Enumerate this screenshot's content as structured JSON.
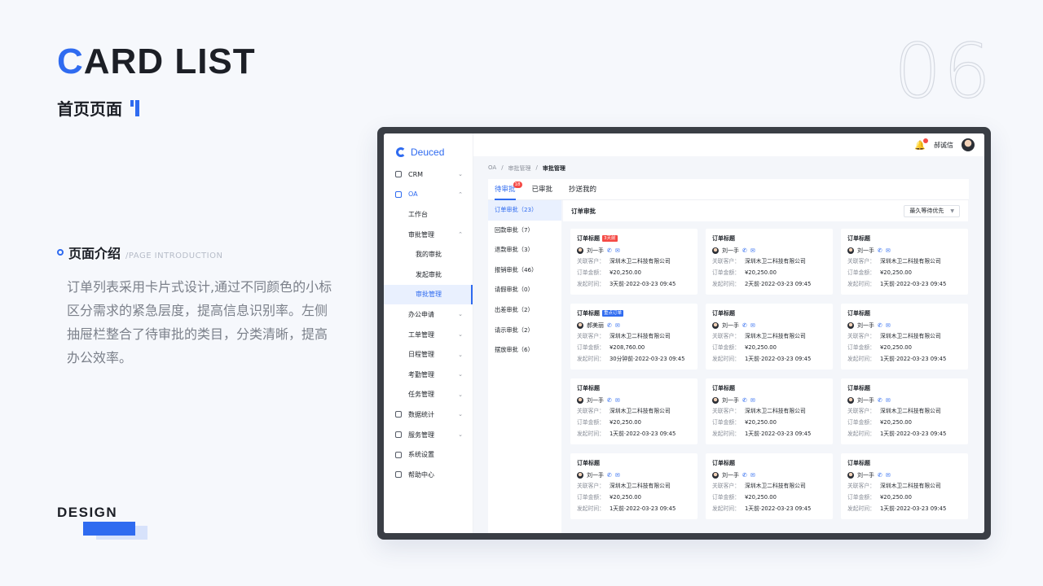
{
  "slide": {
    "title_first": "C",
    "title_rest": "ARD LIST",
    "subtitle": "首页页面",
    "number": "06",
    "intro_title": "页面介绍",
    "intro_en": "/PAGE INTRODUCTION",
    "intro_text": "订单列表采用卡片式设计,通过不同颜色的小标区分需求的紧急层度，提高信息识别率。左侧抽屉栏整合了待审批的类目，分类清晰，提高办公效率。",
    "footer": "DESIGN"
  },
  "colors": {
    "accent": "#2f6bf0",
    "alert": "#f54a45",
    "frame": "#3a3e45"
  },
  "app": {
    "logo": "Deuced",
    "user": "郝诚信",
    "nav": [
      {
        "label": "CRM",
        "icon": "grid-icon",
        "level": 0,
        "chevron": "⌄"
      },
      {
        "label": "OA",
        "icon": "monitor-icon",
        "level": 0,
        "chevron": "⌃",
        "active_parent": true
      },
      {
        "label": "工作台",
        "level": 1,
        "chevron": ""
      },
      {
        "label": "审批管理",
        "level": 1,
        "chevron": "⌃"
      },
      {
        "label": "我的审批",
        "level": 2,
        "chevron": ""
      },
      {
        "label": "发起审批",
        "level": 2,
        "chevron": ""
      },
      {
        "label": "审批管理",
        "level": 2,
        "chevron": "",
        "selected": true
      },
      {
        "label": "办公申请",
        "level": 1,
        "chevron": "⌄"
      },
      {
        "label": "工单管理",
        "level": 1,
        "chevron": "⌄"
      },
      {
        "label": "日程管理",
        "level": 1,
        "chevron": "⌄"
      },
      {
        "label": "考勤管理",
        "level": 1,
        "chevron": "⌄"
      },
      {
        "label": "任务管理",
        "level": 1,
        "chevron": "⌄"
      },
      {
        "label": "数据统计",
        "icon": "chart-icon",
        "level": 0,
        "chevron": "⌄"
      },
      {
        "label": "服务管理",
        "icon": "user-icon",
        "level": 0,
        "chevron": "⌄"
      },
      {
        "label": "系统设置",
        "icon": "gear-icon",
        "level": 0,
        "chevron": ""
      },
      {
        "label": "帮助中心",
        "icon": "help-icon",
        "level": 0,
        "chevron": ""
      }
    ],
    "breadcrumb": [
      "OA",
      "/",
      "审批管理",
      "/",
      "审批管理"
    ],
    "tabs": [
      {
        "label": "待审批",
        "badge": "18",
        "active": true
      },
      {
        "label": "已审批",
        "badge": ""
      },
      {
        "label": "抄送我的",
        "badge": ""
      }
    ],
    "categories": [
      {
        "label": "订单审批（23）",
        "active": true
      },
      {
        "label": "回款审批（7）"
      },
      {
        "label": "退款审批（3）"
      },
      {
        "label": "报销审批（46）"
      },
      {
        "label": "请假审批（0）"
      },
      {
        "label": "出差审批（2）"
      },
      {
        "label": "请示审批（2）"
      },
      {
        "label": "摆放审批（6）"
      }
    ],
    "panel_title": "订单审批",
    "sort_label": "最久等待优先",
    "sort_caret": "▼",
    "field_labels": {
      "customer": "关联客户：",
      "amount": "订单金额：",
      "time": "发起时间："
    },
    "cards": [
      {
        "title": "订单标题",
        "tag": "3天前",
        "tag_color": "red",
        "person": "刘一手",
        "customer": "深圳木卫二科技有限公司",
        "amount": "¥20,250.00",
        "time": "3天前·2022-03-23  09:45"
      },
      {
        "title": "订单标题",
        "tag": "",
        "person": "刘一手",
        "customer": "深圳木卫二科技有限公司",
        "amount": "¥20,250.00",
        "time": "2天前·2022-03-23  09:45"
      },
      {
        "title": "订单标题",
        "tag": "",
        "person": "刘一手",
        "customer": "深圳木卫二科技有限公司",
        "amount": "¥20,250.00",
        "time": "1天前·2022-03-23  09:45"
      },
      {
        "title": "订单标题",
        "tag": "重点订单",
        "tag_color": "blue",
        "person": "郝美丽",
        "customer": "深圳木卫二科技有限公司",
        "amount": "¥208,760.00",
        "time": "30分钟前·2022-03-23  09:45"
      },
      {
        "title": "订单标题",
        "tag": "",
        "person": "刘一手",
        "customer": "深圳木卫二科技有限公司",
        "amount": "¥20,250.00",
        "time": "1天前·2022-03-23  09:45"
      },
      {
        "title": "订单标题",
        "tag": "",
        "person": "刘一手",
        "customer": "深圳木卫二科技有限公司",
        "amount": "¥20,250.00",
        "time": "1天前·2022-03-23  09:45"
      },
      {
        "title": "订单标题",
        "tag": "",
        "person": "刘一手",
        "customer": "深圳木卫二科技有限公司",
        "amount": "¥20,250.00",
        "time": "1天前·2022-03-23  09:45"
      },
      {
        "title": "订单标题",
        "tag": "",
        "person": "刘一手",
        "customer": "深圳木卫二科技有限公司",
        "amount": "¥20,250.00",
        "time": "1天前·2022-03-23  09:45"
      },
      {
        "title": "订单标题",
        "tag": "",
        "person": "刘一手",
        "customer": "深圳木卫二科技有限公司",
        "amount": "¥20,250.00",
        "time": "1天前·2022-03-23  09:45"
      },
      {
        "title": "订单标题",
        "tag": "",
        "person": "刘一手",
        "customer": "深圳木卫二科技有限公司",
        "amount": "¥20,250.00",
        "time": "1天前·2022-03-23  09:45"
      },
      {
        "title": "订单标题",
        "tag": "",
        "person": "刘一手",
        "customer": "深圳木卫二科技有限公司",
        "amount": "¥20,250.00",
        "time": "1天前·2022-03-23  09:45"
      },
      {
        "title": "订单标题",
        "tag": "",
        "person": "刘一手",
        "customer": "深圳木卫二科技有限公司",
        "amount": "¥20,250.00",
        "time": "1天前·2022-03-23  09:45"
      }
    ]
  }
}
